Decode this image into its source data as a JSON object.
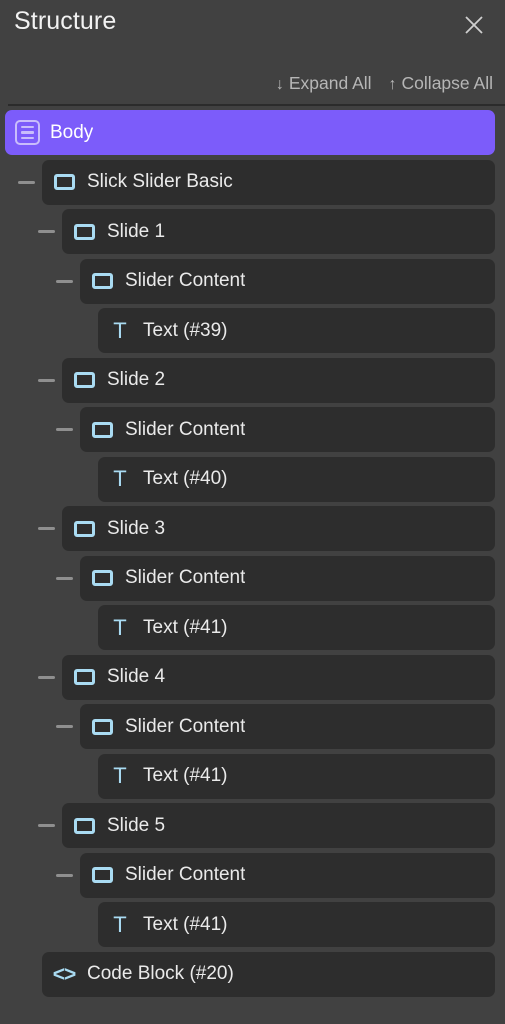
{
  "header": {
    "title": "Structure",
    "close_icon": "close-icon",
    "actions": [
      {
        "arrow": "↓",
        "label": "Expand All",
        "icon": "arrow-down-icon"
      },
      {
        "arrow": "↑",
        "label": "Collapse All",
        "icon": "arrow-up-icon"
      }
    ]
  },
  "colors": {
    "panel_background": "#414141",
    "row_background": "#2d2d2d",
    "selected_row": "#7c5cfa",
    "icon_accent": "#a9dbf2",
    "label_text": "#eaeaea",
    "muted_text": "#b6b6b6",
    "divider": "#2b2b2b"
  },
  "tree": {
    "rows": [
      {
        "label": "Body",
        "icon": "body-icon",
        "depth": 0,
        "selected": true,
        "toggle": false
      },
      {
        "label": "Slick Slider Basic",
        "icon": "element-icon",
        "depth": 1,
        "selected": false,
        "toggle": true
      },
      {
        "label": "Slide 1",
        "icon": "element-icon",
        "depth": 2,
        "selected": false,
        "toggle": true
      },
      {
        "label": "Slider Content",
        "icon": "element-icon",
        "depth": 3,
        "selected": false,
        "toggle": true
      },
      {
        "label": "Text (#39)",
        "icon": "text-icon",
        "depth": 4,
        "selected": false,
        "toggle": false
      },
      {
        "label": "Slide 2",
        "icon": "element-icon",
        "depth": 2,
        "selected": false,
        "toggle": true
      },
      {
        "label": "Slider Content",
        "icon": "element-icon",
        "depth": 3,
        "selected": false,
        "toggle": true
      },
      {
        "label": "Text (#40)",
        "icon": "text-icon",
        "depth": 4,
        "selected": false,
        "toggle": false
      },
      {
        "label": "Slide 3",
        "icon": "element-icon",
        "depth": 2,
        "selected": false,
        "toggle": true
      },
      {
        "label": "Slider Content",
        "icon": "element-icon",
        "depth": 3,
        "selected": false,
        "toggle": true
      },
      {
        "label": "Text (#41)",
        "icon": "text-icon",
        "depth": 4,
        "selected": false,
        "toggle": false
      },
      {
        "label": "Slide 4",
        "icon": "element-icon",
        "depth": 2,
        "selected": false,
        "toggle": true
      },
      {
        "label": "Slider Content",
        "icon": "element-icon",
        "depth": 3,
        "selected": false,
        "toggle": true
      },
      {
        "label": "Text (#41)",
        "icon": "text-icon",
        "depth": 4,
        "selected": false,
        "toggle": false
      },
      {
        "label": "Slide 5",
        "icon": "element-icon",
        "depth": 2,
        "selected": false,
        "toggle": true
      },
      {
        "label": "Slider Content",
        "icon": "element-icon",
        "depth": 3,
        "selected": false,
        "toggle": true
      },
      {
        "label": "Text (#41)",
        "icon": "text-icon",
        "depth": 4,
        "selected": false,
        "toggle": false
      },
      {
        "label": "Code Block (#20)",
        "icon": "code-icon",
        "depth": 1,
        "selected": false,
        "toggle": false
      }
    ]
  }
}
